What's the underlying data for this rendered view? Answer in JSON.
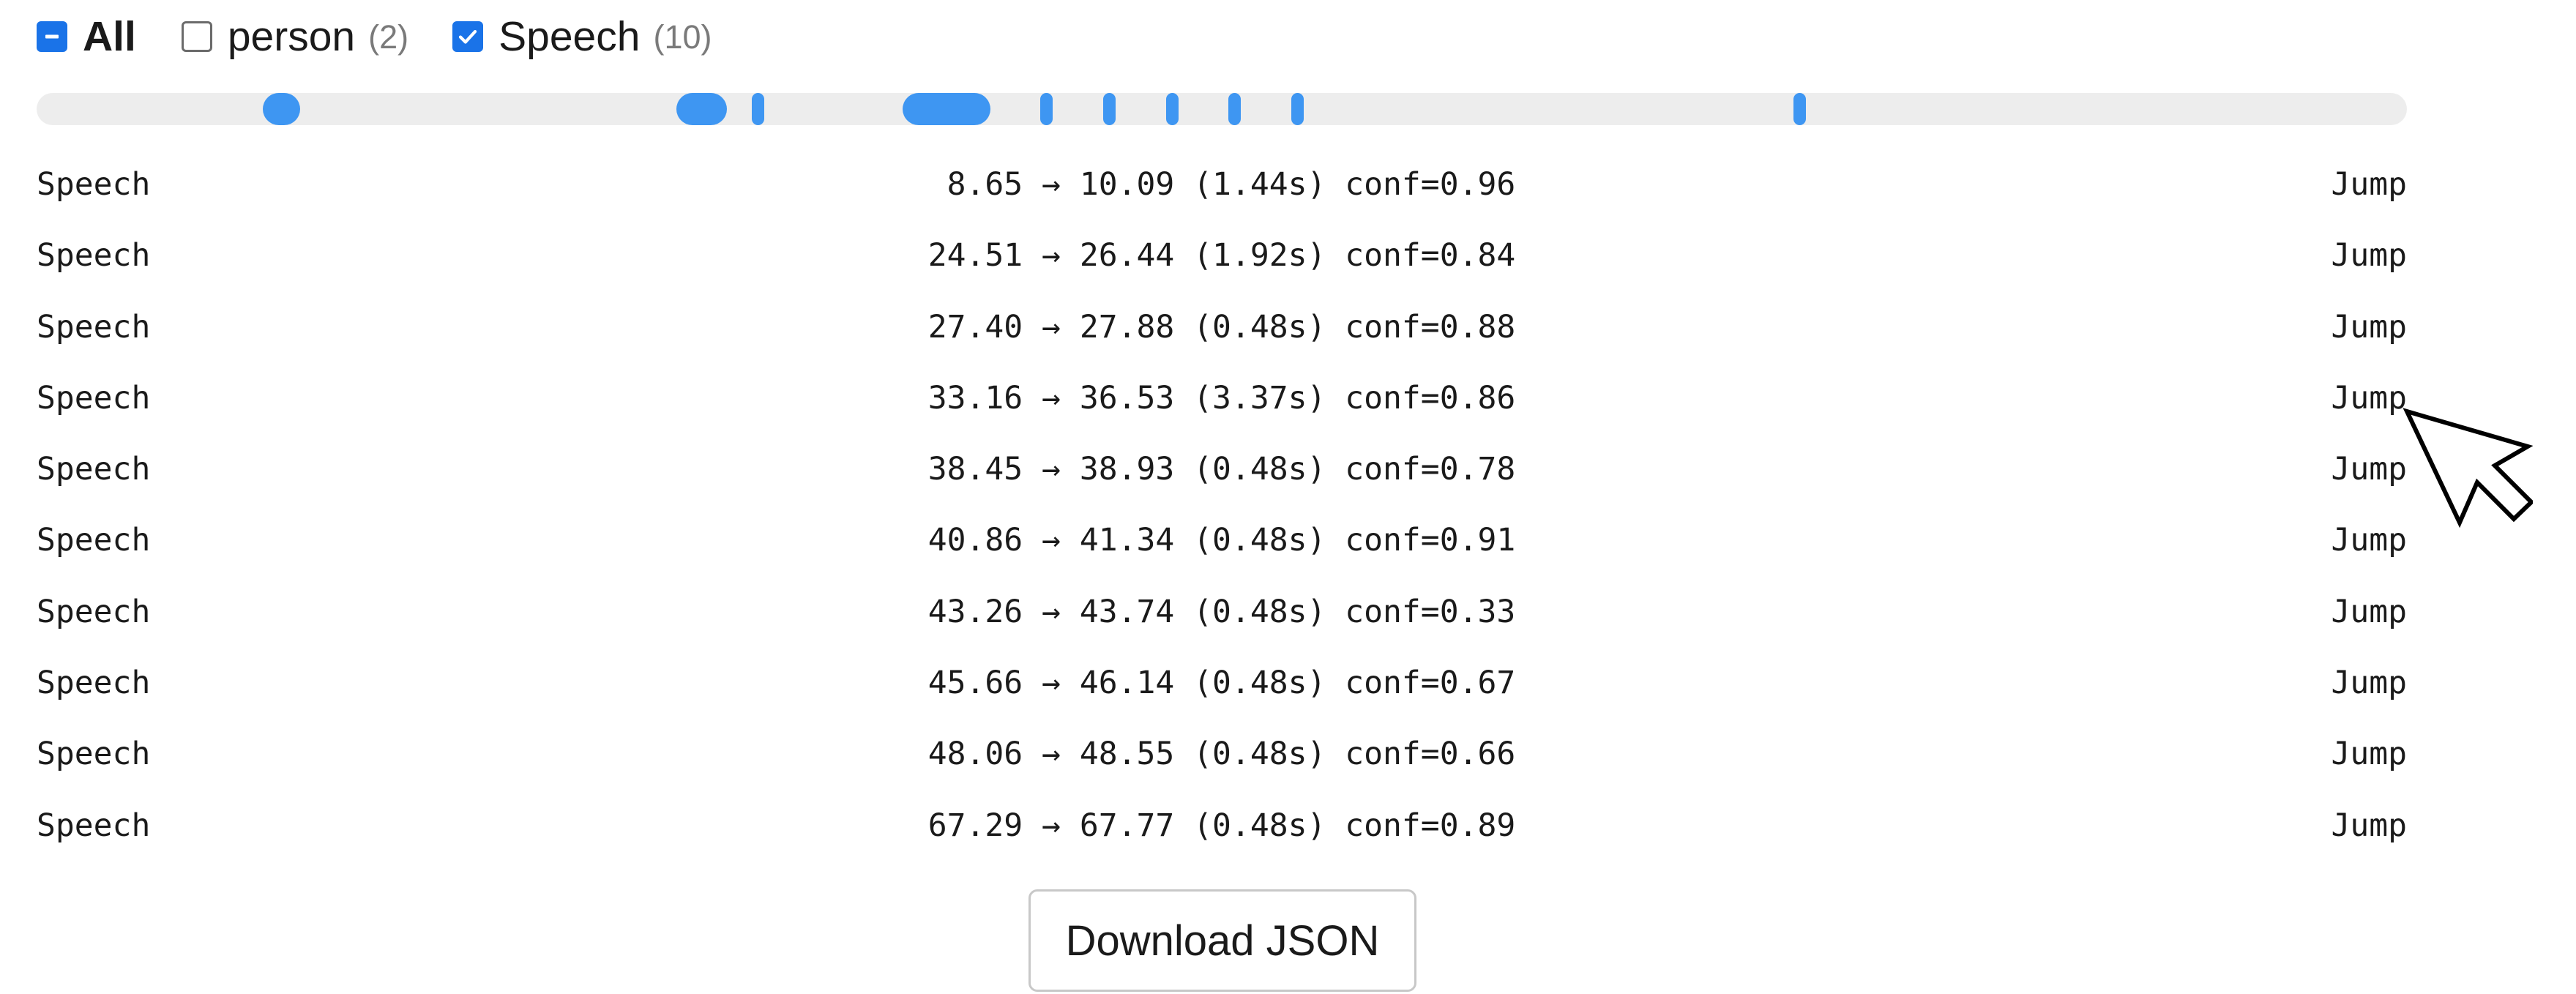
{
  "filters": [
    {
      "id": "all",
      "label": "All",
      "count": "",
      "state": "indeterminate"
    },
    {
      "id": "person",
      "label": "person",
      "count": "(2)",
      "state": "unchecked"
    },
    {
      "id": "speech",
      "label": "Speech",
      "count": "(10)",
      "state": "checked"
    }
  ],
  "colors": {
    "accent": "#1a73e8",
    "segment": "#3e96f2",
    "track": "#ededed"
  },
  "timeline": {
    "duration_seconds": 90.8,
    "segments": [
      {
        "start": 8.65,
        "end": 10.09
      },
      {
        "start": 24.51,
        "end": 26.44
      },
      {
        "start": 27.4,
        "end": 27.88
      },
      {
        "start": 33.16,
        "end": 36.53
      },
      {
        "start": 38.45,
        "end": 38.93
      },
      {
        "start": 40.86,
        "end": 41.34
      },
      {
        "start": 43.26,
        "end": 43.74
      },
      {
        "start": 45.66,
        "end": 46.14
      },
      {
        "start": 48.06,
        "end": 48.55
      },
      {
        "start": 67.29,
        "end": 67.77
      }
    ]
  },
  "detections": [
    {
      "label": "Speech",
      "time": " 8.65 → 10.09 (1.44s) conf=0.96",
      "jump": "Jump"
    },
    {
      "label": "Speech",
      "time": "24.51 → 26.44 (1.92s) conf=0.84",
      "jump": "Jump"
    },
    {
      "label": "Speech",
      "time": "27.40 → 27.88 (0.48s) conf=0.88",
      "jump": "Jump"
    },
    {
      "label": "Speech",
      "time": "33.16 → 36.53 (3.37s) conf=0.86",
      "jump": "Jump"
    },
    {
      "label": "Speech",
      "time": "38.45 → 38.93 (0.48s) conf=0.78",
      "jump": "Jump"
    },
    {
      "label": "Speech",
      "time": "40.86 → 41.34 (0.48s) conf=0.91",
      "jump": "Jump"
    },
    {
      "label": "Speech",
      "time": "43.26 → 43.74 (0.48s) conf=0.33",
      "jump": "Jump"
    },
    {
      "label": "Speech",
      "time": "45.66 → 46.14 (0.48s) conf=0.67",
      "jump": "Jump"
    },
    {
      "label": "Speech",
      "time": "48.06 → 48.55 (0.48s) conf=0.66",
      "jump": "Jump"
    },
    {
      "label": "Speech",
      "time": "67.29 → 67.77 (0.48s) conf=0.89",
      "jump": "Jump"
    }
  ],
  "download_button": {
    "label": "Download JSON"
  },
  "cursor": {
    "icon": "arrow-cursor-icon"
  }
}
